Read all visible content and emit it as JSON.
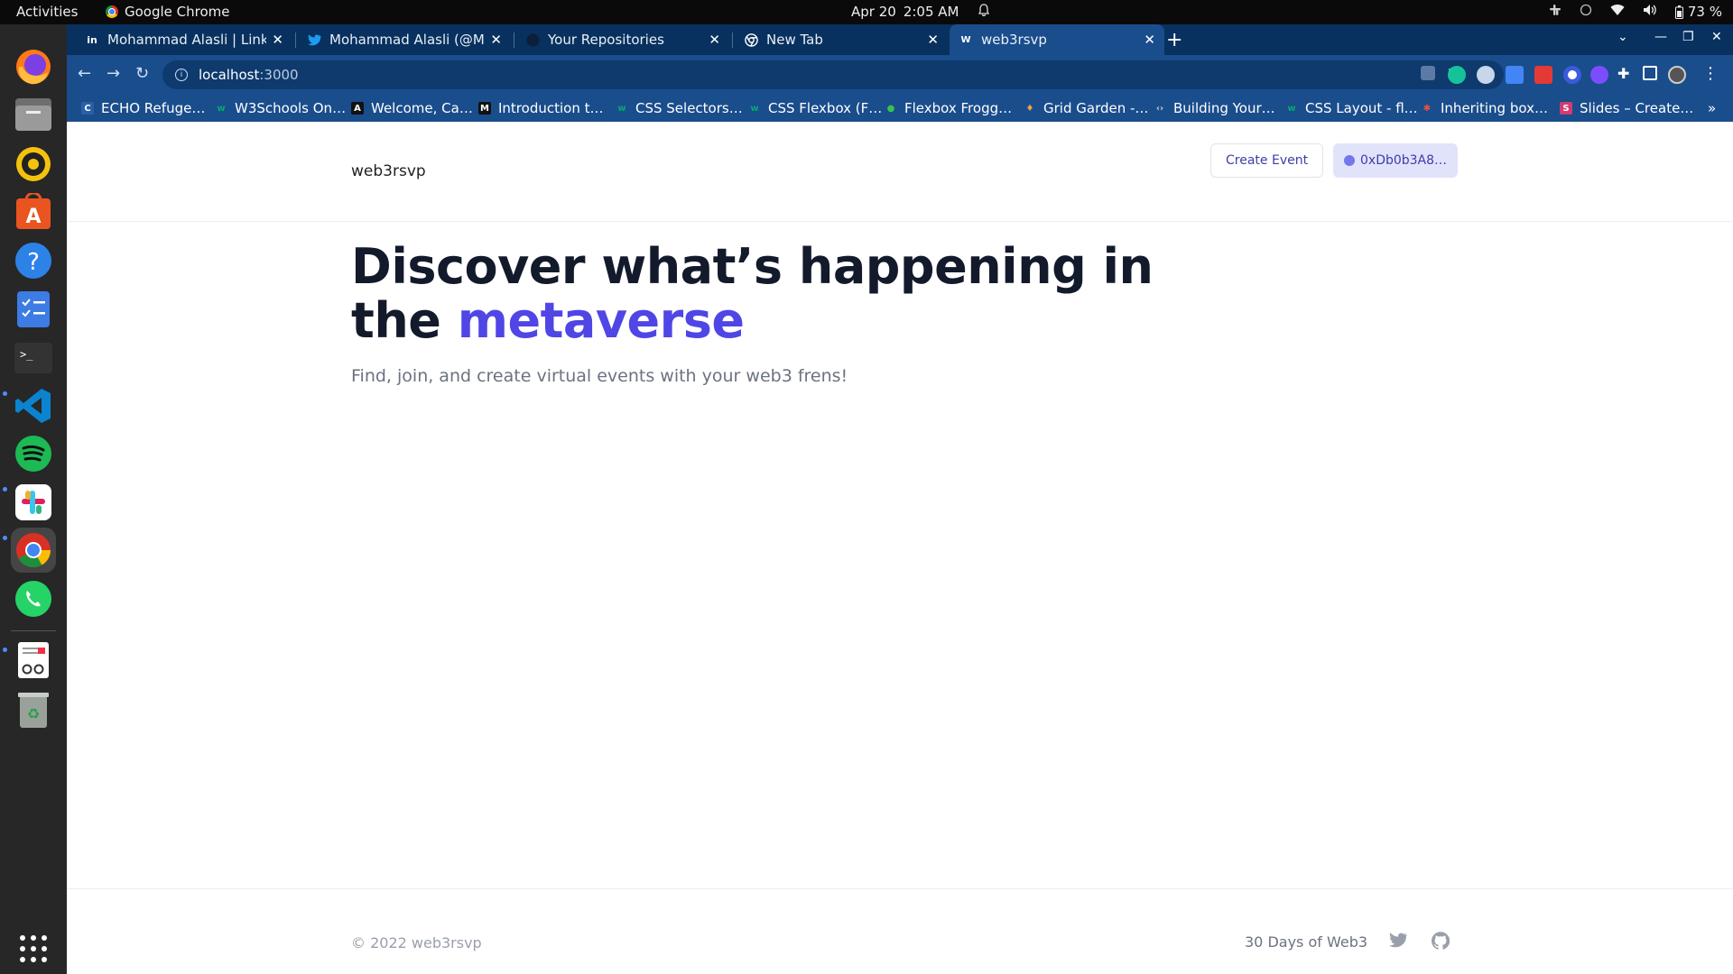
{
  "topbar": {
    "activities": "Activities",
    "app_name": "Google Chrome",
    "date": "Apr 20",
    "time": "2:05 AM",
    "battery": "73 %"
  },
  "dock": {
    "apps": [
      "firefox-icon",
      "files-icon",
      "rhythmbox-icon",
      "software-icon",
      "help-icon",
      "tasks-icon",
      "terminal-icon",
      "vscode-icon",
      "spotify-icon",
      "slack-icon",
      "chrome-icon",
      "whatsapp-icon",
      "reader-icon",
      "trash-icon",
      "app-grid-icon"
    ]
  },
  "tabs": [
    {
      "title": "Mohammad Alasli | LinkedIn",
      "icon": "linkedin-icon",
      "active": false
    },
    {
      "title": "Mohammad Alasli (@Moh",
      "icon": "twitter-icon",
      "active": false
    },
    {
      "title": "Your Repositories",
      "icon": "github-icon",
      "active": false
    },
    {
      "title": "New Tab",
      "icon": "chrome-icon",
      "active": false
    },
    {
      "title": "web3rsvp",
      "icon": "w3-icon",
      "active": true
    }
  ],
  "address": {
    "url_host": "localhost",
    "url_port": ":3000"
  },
  "bookmarks": [
    "ECHO Refuge…",
    "W3Schools On…",
    "Welcome, Ca…",
    "Introduction t…",
    "CSS Selectors…",
    "CSS Flexbox (F…",
    "Flexbox Frogg…",
    "Grid Garden -…",
    "Building Your…",
    "CSS Layout - fl…",
    "Inheriting box…",
    "Slides – Create…"
  ],
  "site": {
    "brand": "web3rsvp",
    "create_event": "Create Event",
    "wallet": "0xDb0b3A8…",
    "hero_line1": "Discover what’s happening in",
    "hero_line2_plain": "the ",
    "hero_line2_accent": "metaverse",
    "subtitle": "Find, join, and create virtual events with your web3 frens!",
    "copyright": "© 2022 web3rsvp",
    "footer_link": "30 Days of Web3"
  },
  "colors": {
    "accent": "#4f46e5",
    "tabstrip": "#08315f",
    "toolbar": "#1a4d8c",
    "heading": "#131a2b"
  }
}
